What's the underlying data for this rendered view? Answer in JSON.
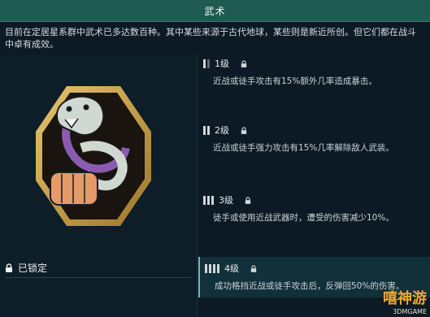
{
  "header": {
    "title": "武术"
  },
  "description": "目前在定居星系群中武术已多达数百种。其中某些来源于古代地球，某些则是新近所创。但它们都在战斗中卓有成效。",
  "emblem": {
    "icon": "snake-fist-emblem"
  },
  "status": {
    "locked_label": "已锁定"
  },
  "tiers": [
    {
      "name": "1级",
      "description": "近战或徒手攻击有15%额外几率造成暴击。",
      "locked": true
    },
    {
      "name": "2级",
      "description": "近战或徒手强力攻击有15%几率解除敌人武装。",
      "locked": true
    },
    {
      "name": "3级",
      "description": "徒手或使用近战武器时，遭受的伤害减少10%。",
      "locked": true
    },
    {
      "name": "4级",
      "description": "成功格挡近战或徒手攻击后，反弹回50%的伤害。",
      "locked": true
    }
  ],
  "watermark": {
    "main": "嘻神游",
    "sub": "3DMGAME"
  },
  "colors": {
    "header_bg": "#1e5a4f",
    "background": "#0b1a24",
    "emblem_gold": "#c9a24a",
    "snake_purple": "#8a5bb0"
  }
}
